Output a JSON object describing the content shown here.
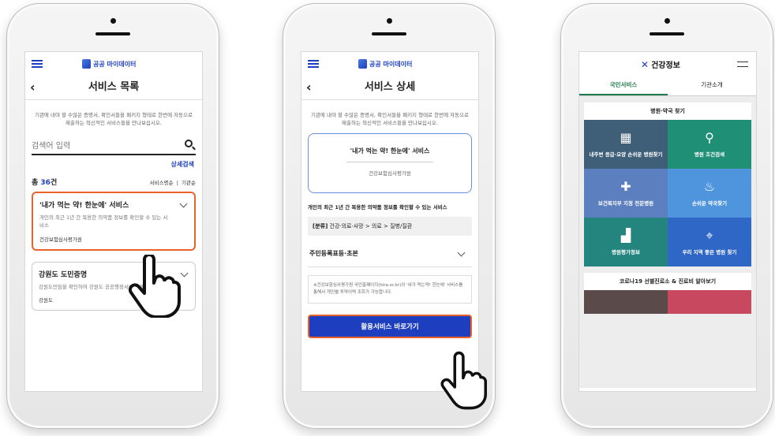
{
  "screen1": {
    "logo": "공공 마이데이터",
    "title": "서비스 목록",
    "intro": "기관에 내야 할 수많은 증명서, 확인서들을 패키지 형태로 한번에 자동으로 제출하는 혁신적인 서비스들을 만나보십시오.",
    "search_placeholder": "검색어 입력",
    "advanced": "상세검색",
    "count_prefix": "총 ",
    "count_num": "36",
    "count_suffix": "건",
    "sort_name": "서비스명순",
    "sort_org": "기관순",
    "cards": [
      {
        "title": "'내가 먹는 약! 한눈에' 서비스",
        "desc": "개인의 최근 1년 간 복용한 의약품 정보를 확인할 수 있는 서비스",
        "org": "건강보험심사평가원"
      },
      {
        "title": "강원도 도민증명",
        "desc": "강원도민임을 확인하여 강원도 공공행정서비스 제공",
        "org": "강원도"
      }
    ]
  },
  "screen2": {
    "logo": "공공 마이데이터",
    "title": "서비스 상세",
    "intro": "기관에 내야 할 수많은 증명서, 확인서들을 패키지 형태로 한번에 자동으로 제출하는 혁신적인 서비스들을 만나보십시오.",
    "svc_title": "'내가 먹는 약! 한눈에' 서비스",
    "svc_org": "건강보험심사평가원",
    "desc": "개인의 최근 1년 간 복용한 의약품 정보를 확인할 수 있는 서비스",
    "cat_label": "[분류]",
    "cat_value": " 건강·의료·사망 > 의료 > 질병/질환",
    "accordion": "주민등록표등·초본",
    "note": "※건강보험심사평가원 국민홈페이지(hira.or.kr)의 '내가 먹는약! 한눈에' 서비스를 통해서 개인별 투약이력 조회가 가능합니다.",
    "go_button": "활용서비스 바로가기"
  },
  "screen3": {
    "logo": "건강정보",
    "tab_active": "국민서비스",
    "tab_other": "기관소개",
    "section1": "병원·약국 찾기",
    "tiles": [
      {
        "label": "내주변 응급·요양 손쉬운 병원찾기",
        "icon": "▦",
        "color": "#3f5e78"
      },
      {
        "label": "병원 조건검색",
        "icon": "⚲",
        "color": "#1f8f76"
      },
      {
        "label": "보건복지부 지정 전문병원",
        "icon": "✚",
        "color": "#5b7fbf"
      },
      {
        "label": "손쉬운 약국찾기",
        "icon": "♨",
        "color": "#4f95dd"
      },
      {
        "label": "병원평가정보",
        "icon": "▟",
        "color": "#23857e"
      },
      {
        "label": "우리 지역 좋은 병원 찾기",
        "icon": "⌖",
        "color": "#2f67c6"
      }
    ],
    "section2": "코로나19 선별진료소 & 진료비 알아보기",
    "bottom_tiles": [
      {
        "color": "#5a4a4a"
      },
      {
        "color": "#c8485f"
      }
    ]
  }
}
